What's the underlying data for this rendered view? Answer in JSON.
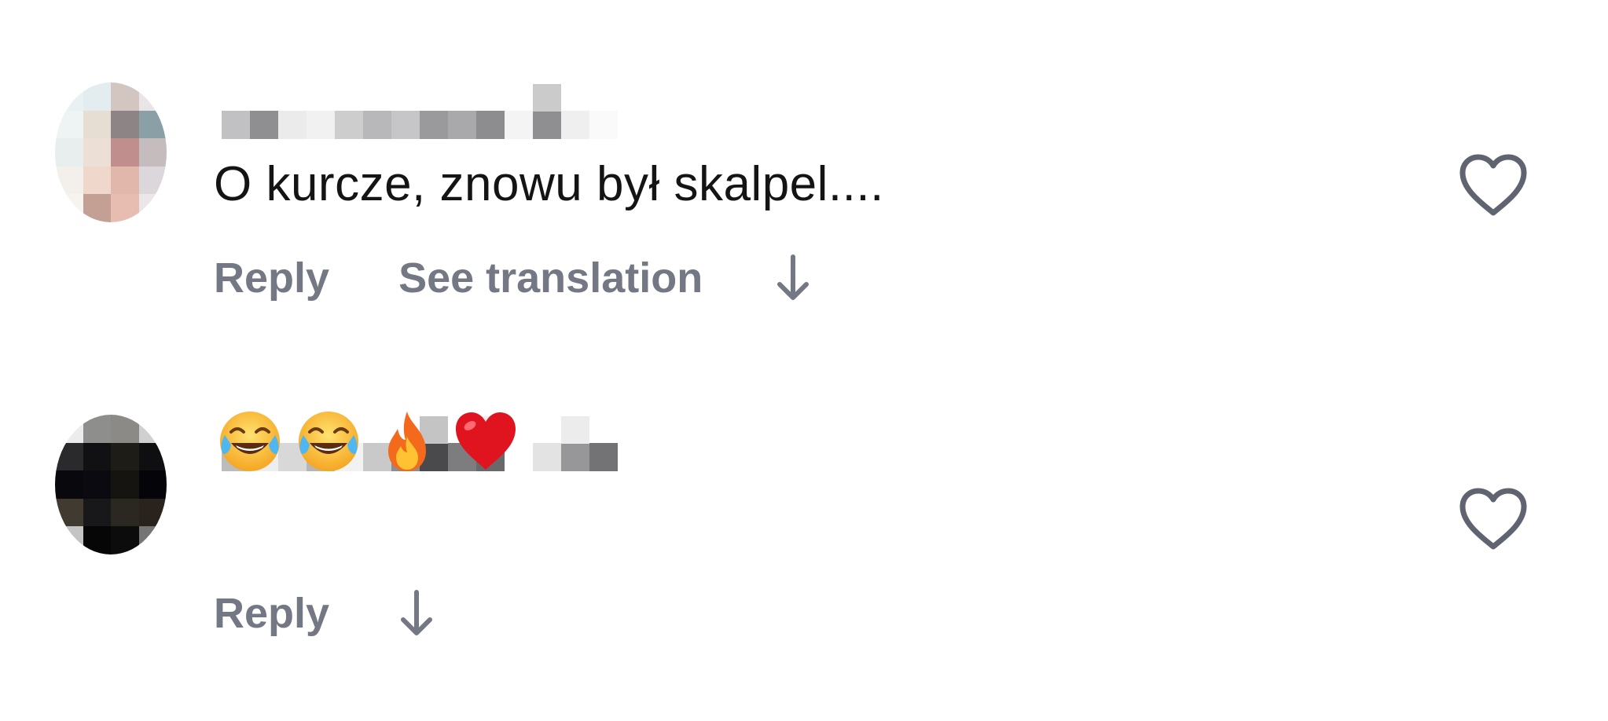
{
  "comments": [
    {
      "text": "O kurcze, znowu był skalpel....",
      "actions": {
        "reply_label": "Reply",
        "translate_label": "See translation",
        "expand_icon": "arrow-down-icon"
      },
      "like_icon": "heart-outline-icon"
    },
    {
      "emojis": [
        "😂",
        "😂",
        "🔥",
        "❤️"
      ],
      "emoji_icons": [
        "face-with-tears-of-joy-emoji",
        "face-with-tears-of-joy-emoji",
        "fire-emoji",
        "red-heart-emoji"
      ],
      "actions": {
        "reply_label": "Reply",
        "expand_icon": "arrow-down-icon"
      },
      "like_icon": "heart-outline-icon"
    }
  ],
  "colors": {
    "action_text": "#737884",
    "comment_text": "#141414",
    "heart_outline": "#5f6470"
  }
}
